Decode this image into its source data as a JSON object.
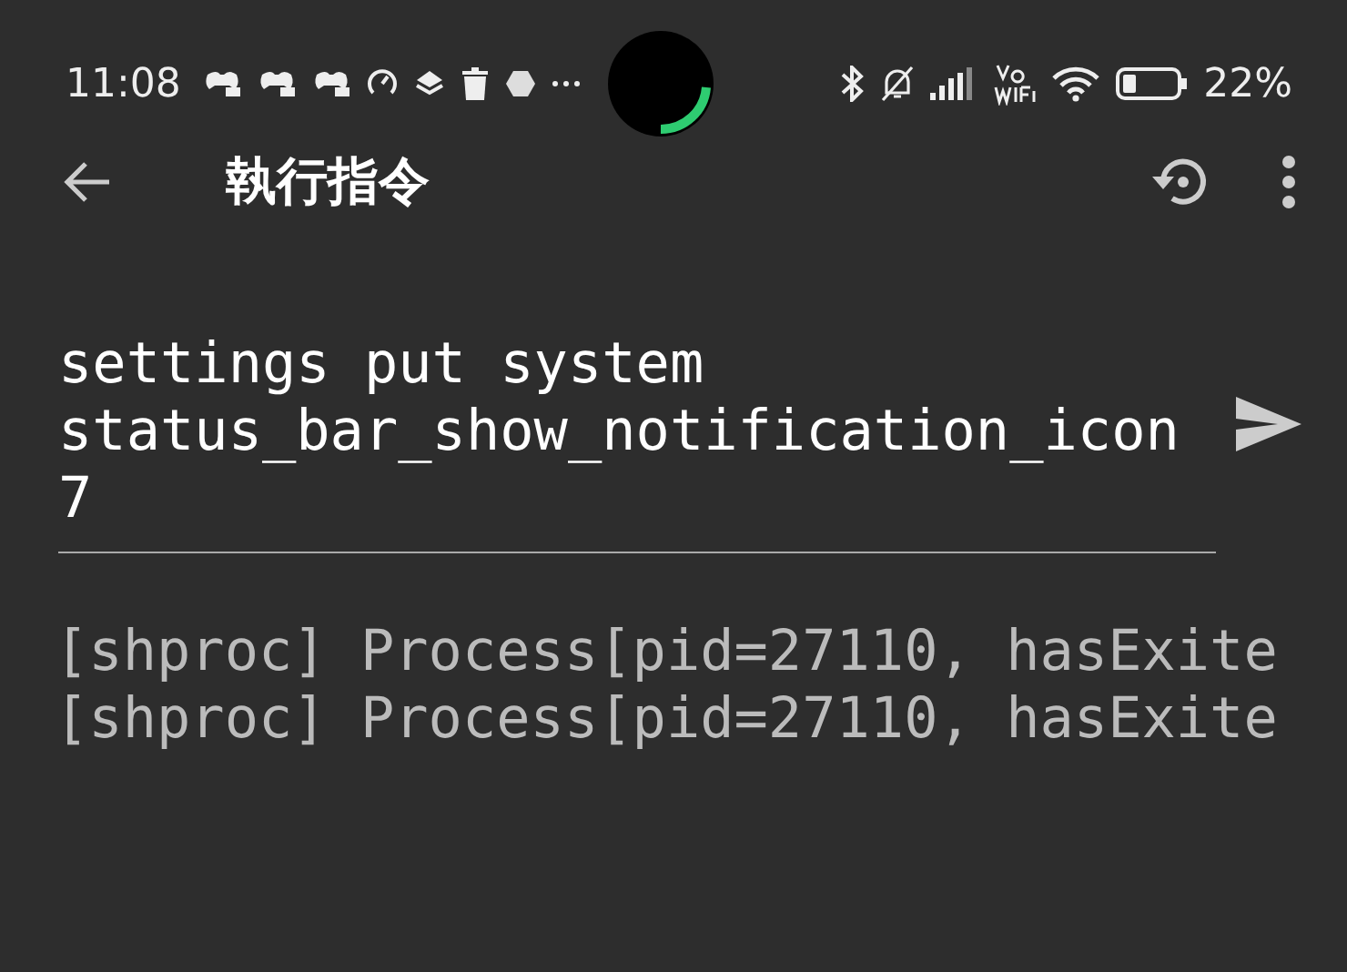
{
  "status_bar": {
    "time": "11:08",
    "battery_percent": "22%"
  },
  "toolbar": {
    "title": "執行指令"
  },
  "command_input": {
    "value": "settings put system status_bar_show_notification_icon 7"
  },
  "output_lines": [
    "[shproc] Process[pid=27110, hasExite",
    "[shproc] Process[pid=27110, hasExite"
  ]
}
